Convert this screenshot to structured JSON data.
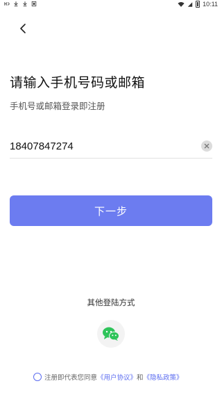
{
  "status_bar": {
    "time": "10:11",
    "left_icons": [
      "signal-h-icon",
      "download-icon",
      "download-icon",
      "notification-icon"
    ],
    "right_icons": [
      "wifi-icon",
      "signal-icon",
      "battery-icon"
    ]
  },
  "header": {
    "title": "请输入手机号码或邮箱",
    "subtitle": "手机号或邮箱登录即注册"
  },
  "form": {
    "phone_value": "18407847274"
  },
  "next_button": {
    "label": "下一步",
    "color": "#6c7cf0"
  },
  "other_login": {
    "label": "其他登陆方式",
    "methods": [
      "wechat-icon"
    ]
  },
  "agreement": {
    "prefix": "注册即代表您同意",
    "user_agreement": "《用户协议》",
    "and": "和",
    "privacy_policy": "《隐私政策》",
    "link_color": "#5b6cf0"
  }
}
